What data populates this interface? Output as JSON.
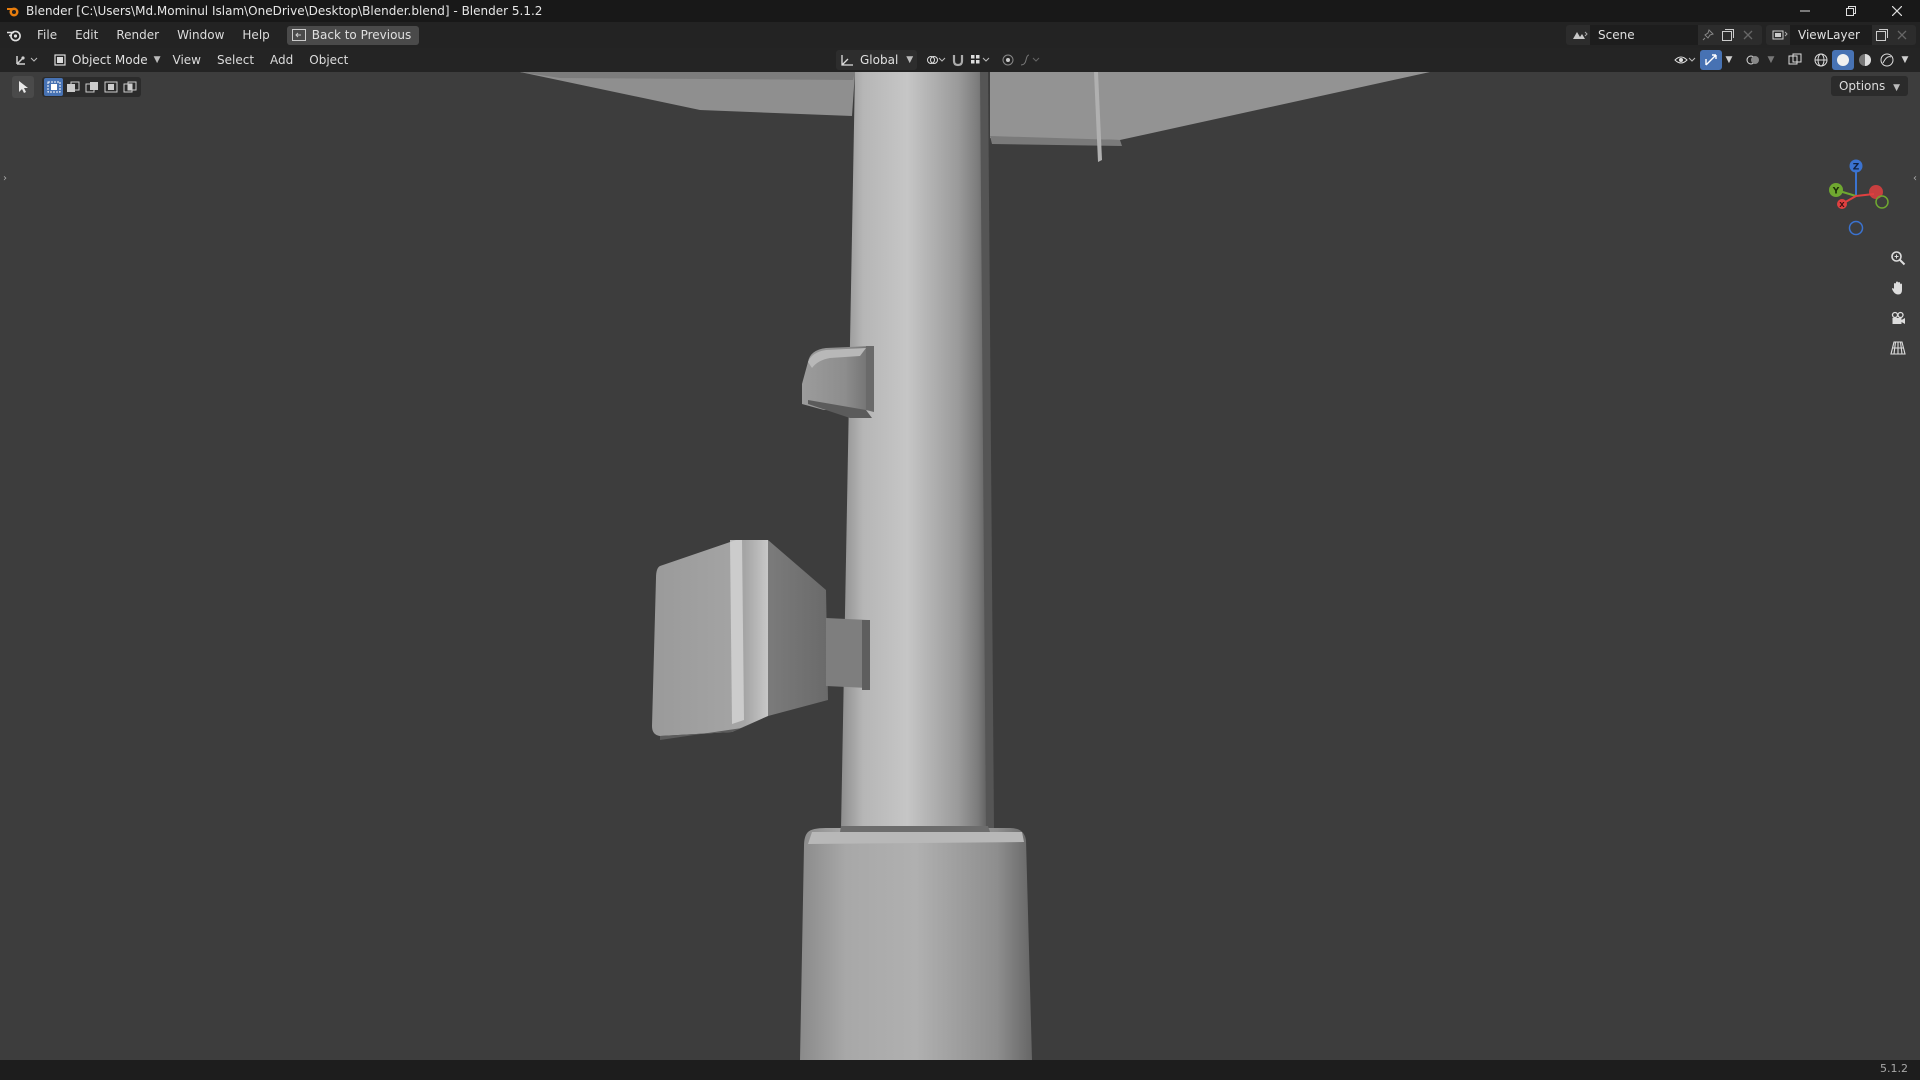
{
  "window": {
    "title": "Blender [C:\\Users\\Md.Mominul Islam\\OneDrive\\Desktop\\Blender.blend] - Blender 5.1.2",
    "controls": [
      "minimize",
      "restore",
      "close"
    ]
  },
  "topbar": {
    "menus": [
      "File",
      "Edit",
      "Render",
      "Window",
      "Help"
    ],
    "back_button": "Back to Previous",
    "scene": "Scene",
    "view_layer": "ViewLayer"
  },
  "viewport_header": {
    "mode": "Object Mode",
    "menus": [
      "View",
      "Select",
      "Add",
      "Object"
    ],
    "orientation": "Global",
    "options": "Options"
  },
  "icons": {
    "app": "blender-icon",
    "editor_type": "3d-viewport-icon",
    "zoom": "magnifier-icon",
    "pan": "hand-icon",
    "camera": "camera-icon",
    "perspective": "grid-icon"
  },
  "gizmo": {
    "axes": [
      "Z",
      "Y",
      "X"
    ]
  },
  "colors": {
    "accent": "#4772b3",
    "x_axis": "#e04040",
    "y_axis": "#6fa830",
    "z_axis": "#3b73d0"
  },
  "statusbar": {
    "version": "5.1.2"
  }
}
